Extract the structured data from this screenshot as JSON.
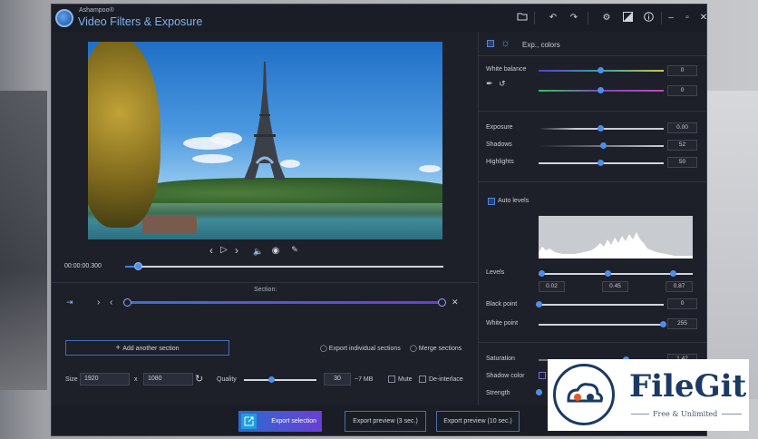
{
  "app": {
    "vendor": "Ashampoo®",
    "title": "Video Filters & Exposure"
  },
  "player": {
    "timecode": "00:00:00.300",
    "position_fraction": 0.04
  },
  "section": {
    "label": "Section:",
    "add_button": "Add another section",
    "export_individual": "Export individual sections",
    "merge_sections": "Merge sections"
  },
  "output": {
    "size_label": "Size",
    "width": "1920",
    "x_sep": "x",
    "height": "1080",
    "quality_label": "Quality",
    "quality_value": "30",
    "file_size": "~7 MB",
    "quality_fraction": 0.37,
    "mute_label": "Mute",
    "deinterlace_label": "De-interlace"
  },
  "bottom": {
    "export_selection": "Export selection",
    "preview_3": "Export preview (3 sec.)",
    "preview_10": "Export preview (10 sec.)"
  },
  "panel": {
    "title": "Exp., colors",
    "white_balance_label": "White balance",
    "wb1_value": "0",
    "wb2_value": "0",
    "exposure_label": "Exposure",
    "exposure_value": "0.00",
    "shadows_label": "Shadows",
    "shadows_value": "52",
    "highlights_label": "Highlights",
    "highlights_value": "50",
    "auto_levels_label": "Auto levels",
    "levels_label": "Levels",
    "levels_low": "0.02",
    "levels_mid": "0.45",
    "levels_high": "0.87",
    "black_point_label": "Black point",
    "black_point_value": "0",
    "white_point_label": "White point",
    "white_point_value": "255",
    "saturation_label": "Saturation",
    "saturation_value": "1.42",
    "shadow_color_label": "Shadow color",
    "strength_label": "Strength"
  },
  "watermark": {
    "name": "FileGit",
    "tagline": "Free & Unlimited"
  },
  "colors": {
    "accent": "#3f7fe8",
    "gradient_end": "#6a3fd6",
    "background": "#1d2029"
  }
}
